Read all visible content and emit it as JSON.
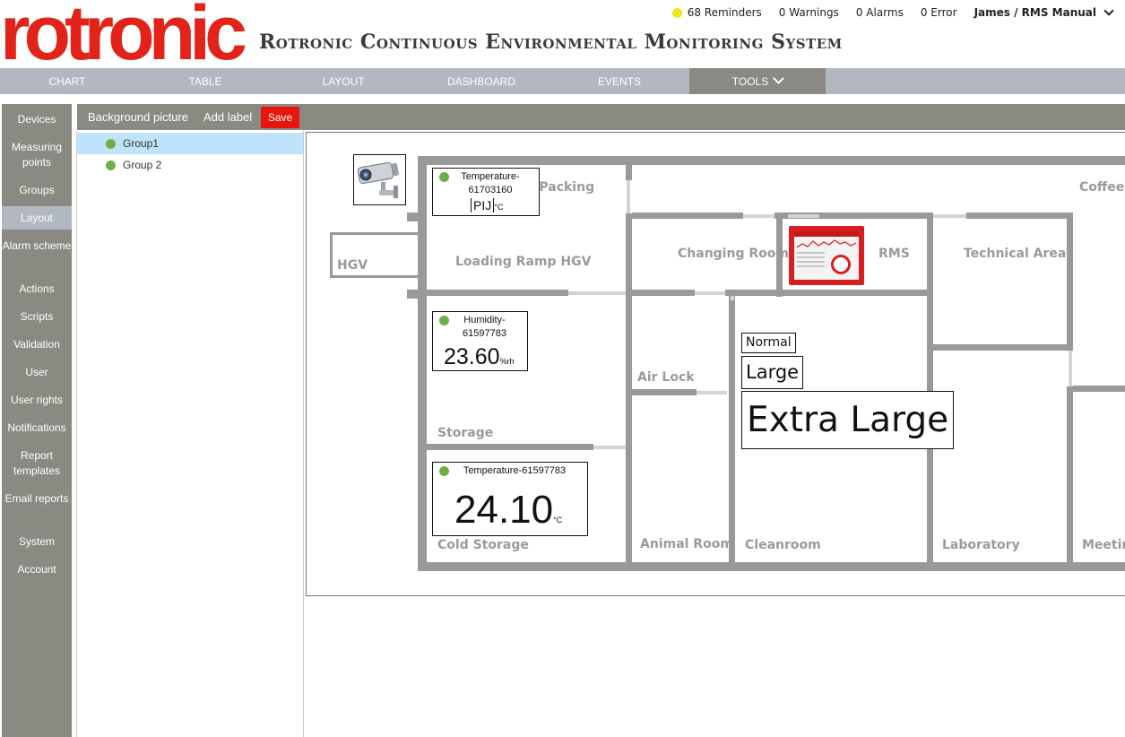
{
  "brand": {
    "logo_text": "rotronic",
    "title": "Rotronic Continuous Environmental Monitoring System"
  },
  "status": {
    "reminders": "68 Reminders",
    "warnings": "0 Warnings",
    "alarms": "0 Alarms",
    "errors": "0 Error",
    "user": "James / RMS Manual",
    "reminder_color": "#f0e41a"
  },
  "nav": {
    "tabs": [
      {
        "label": "CHART"
      },
      {
        "label": "TABLE"
      },
      {
        "label": "LAYOUT"
      },
      {
        "label": "DASHBOARD"
      },
      {
        "label": "EVENTS"
      },
      {
        "label": "TOOLS"
      }
    ],
    "active": "TOOLS"
  },
  "sidebar": {
    "items": [
      {
        "label": "Devices"
      },
      {
        "label": "Measuring points"
      },
      {
        "label": "Groups"
      },
      {
        "label": "Layout"
      },
      {
        "label": "Alarm scheme"
      },
      {
        "label": "Actions"
      },
      {
        "label": "Scripts"
      },
      {
        "label": "Validation"
      },
      {
        "label": "User"
      },
      {
        "label": "User rights"
      },
      {
        "label": "Notifications"
      },
      {
        "label": "Report templates"
      },
      {
        "label": "Email reports"
      },
      {
        "label": "System"
      },
      {
        "label": "Account"
      }
    ],
    "active": "Layout"
  },
  "toolbar": {
    "background_picture": "Background picture",
    "add_label": "Add label",
    "save": "Save",
    "save_color": "#e8150c"
  },
  "groups": {
    "items": [
      {
        "label": "Group1",
        "selected": true
      },
      {
        "label": "Group 2",
        "selected": false
      }
    ],
    "status_color": "#6db046"
  },
  "floorplan": {
    "rooms": {
      "packing": "n)Packing",
      "coffee": "Coffee C",
      "hgv": "HGV",
      "loading_ramp": "Loading Ramp HGV",
      "changing_room": "Changing Room",
      "rms": "RMS",
      "technical_area": "Technical Area",
      "air_lock": "Air Lock",
      "storage": "Storage",
      "cold_storage": "Cold Storage",
      "animal_room": "Animal Room",
      "cleanroom": "Cleanroom",
      "laboratory": "Laboratory",
      "meeting": "Meetin"
    },
    "sensors": [
      {
        "name": "Temperature-61703160",
        "value": "PIJ",
        "unit": "°C"
      },
      {
        "name": "Humidity-61597783",
        "value": "23.60",
        "unit": "%rh"
      },
      {
        "name": "Temperature-61597783",
        "value": "24.10",
        "unit": "°C"
      }
    ],
    "labels": {
      "normal": "Normal",
      "large": "Large",
      "extra_large": "Extra Large"
    }
  }
}
